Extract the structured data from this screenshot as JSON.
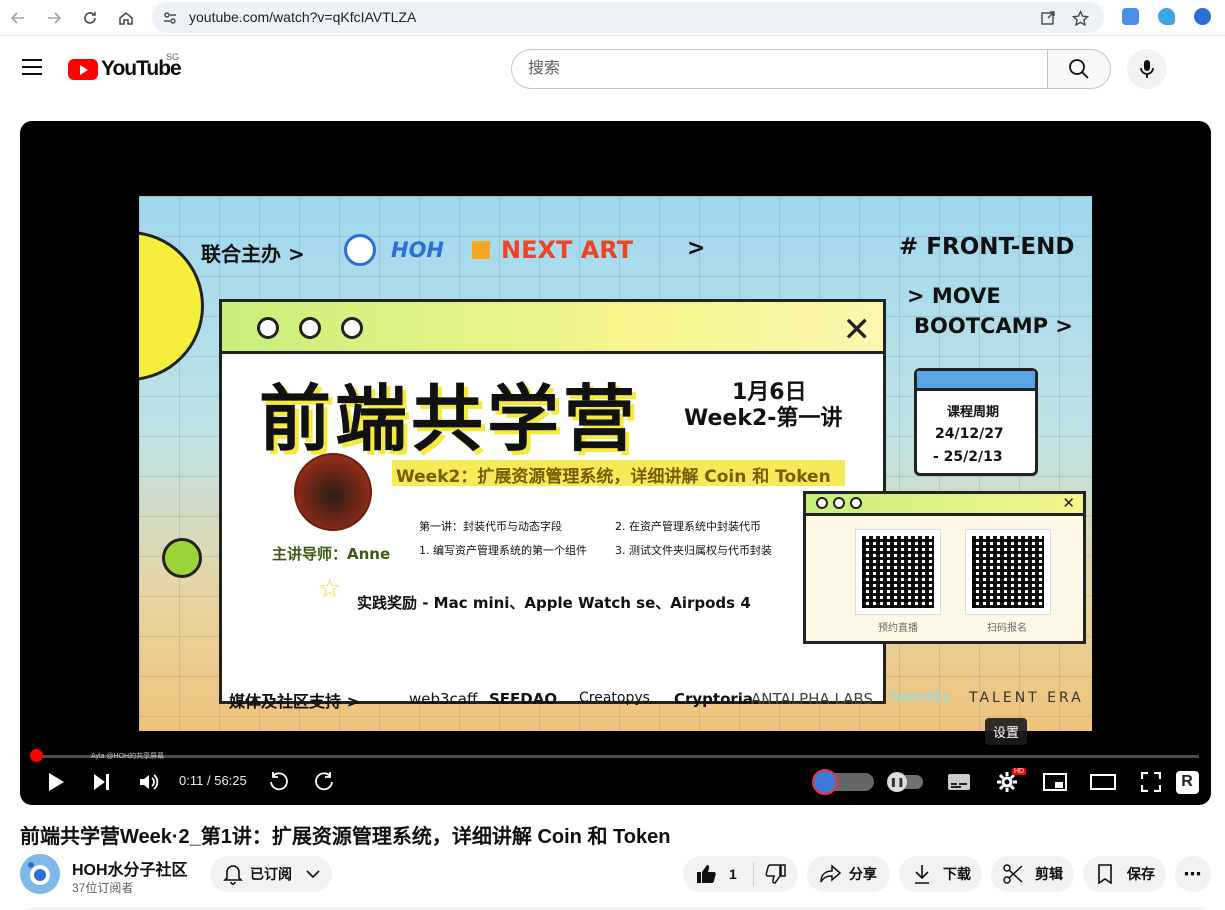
{
  "browser": {
    "url": "youtube.com/watch?v=qKfcIAVTLZA"
  },
  "header": {
    "logo_text": "YouTube",
    "region": "SG",
    "search_placeholder": "搜索"
  },
  "player": {
    "time_current": "0:11",
    "time_separator": "/",
    "time_total": "56:25",
    "progress": 0.0032,
    "tooltip": "设置",
    "overlay_tag": "Ayla @HOH的共享屏幕",
    "settings_badge": "HD"
  },
  "slide": {
    "sponsor_label": "联合主办 >",
    "sponsor_hoh": "HOH",
    "sponsor_next": "NEXT ART",
    "front_end": "# FRONT-END",
    "move": "> MOVE",
    "bootcamp": "BOOTCAMP >",
    "main_title": "前端共学营",
    "date": "1月6日",
    "week_label": "Week2-第一讲",
    "week_banner": "Week2：扩展资源管理系统，详细讲解 Coin 和 Token",
    "calendar_title": "课程周期",
    "calendar_start": "24/12/27",
    "calendar_end": "- 25/2/13",
    "topic_1": "第一讲：封装代币与动态字段",
    "topic_2": "2. 在资产管理系统中封装代币",
    "topic_3": "1. 编写资产管理系统的第一个组件",
    "topic_4": "3. 测试文件夹归属权与代币封装",
    "mentor": "主讲导师：Anne",
    "rewards": "实践奖励 - Mac mini、Apple Watch se、Airpods 4",
    "qr_label_1": "预约直播",
    "qr_label_2": "扫码报名",
    "media_label": "媒体及社区支持 >",
    "partners": [
      "web3caff",
      "SEEDAO",
      "Creatopys",
      "Cryptoria.",
      "ANTALPHA LABS",
      "TalentEx",
      "TALENT ERA"
    ]
  },
  "video": {
    "title": "前端共学营Week·2_第1讲：扩展资源管理系统，详细讲解 Coin 和 Token",
    "channel_name": "HOH水分子社区",
    "subscribers": "37位订阅者",
    "subscribe_label": "已订阅",
    "likes": "1",
    "share_label": "分享",
    "download_label": "下载",
    "clip_label": "剪辑",
    "save_label": "保存"
  }
}
